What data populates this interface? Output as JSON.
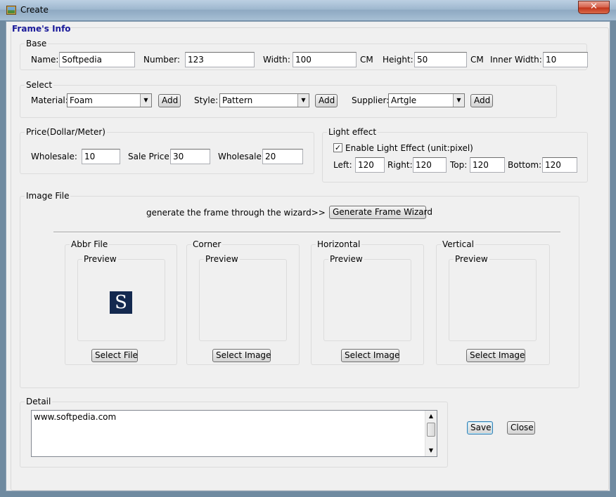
{
  "window": {
    "title": "Create",
    "close_glyph": "✕"
  },
  "frame_info": {
    "label": "Frame's Info"
  },
  "base": {
    "label": "Base",
    "name_label": "Name:",
    "name_value": "Softpedia",
    "number_label": "Number:",
    "number_value": "123",
    "width_label": "Width:",
    "width_value": "100",
    "width_unit": "CM",
    "height_label": "Height:",
    "height_value": "50",
    "height_unit": "CM",
    "inner_width_label": "Inner Width:",
    "inner_width_value": "10"
  },
  "select": {
    "label": "Select",
    "material_label": "Material:",
    "material_value": "Foam",
    "style_label": "Style:",
    "style_value": "Pattern",
    "supplier_label": "Supplier:",
    "supplier_value": "Artgle",
    "add_label": "Add"
  },
  "price": {
    "label": "Price(Dollar/Meter)",
    "wholesale_label": "Wholesale:",
    "wholesale_value": "10",
    "sale_price_label": "Sale Price:",
    "sale_price_value": "30",
    "wholesale2_label": "Wholesale:",
    "wholesale2_value": "20"
  },
  "light_effect": {
    "label": "Light effect",
    "enable_label": "Enable Light Effect  (unit:pixel)",
    "enable_checked": "✓",
    "left_label": "Left:",
    "left_value": "120",
    "right_label": "Right:",
    "right_value": "120",
    "top_label": "Top:",
    "top_value": "120",
    "bottom_label": "Bottom:",
    "bottom_value": "120"
  },
  "image_file": {
    "label": "Image File",
    "wizard_text": "generate the frame  through the wizard>>",
    "wizard_button": "Generate Frame Wizard",
    "panels": [
      {
        "title": "Abbr File",
        "preview": "Preview",
        "button": "Select File",
        "logo": "S"
      },
      {
        "title": "Corner",
        "preview": "Preview",
        "button": "Select Image"
      },
      {
        "title": "Horizontal",
        "preview": "Preview",
        "button": "Select Image"
      },
      {
        "title": "Vertical",
        "preview": "Preview",
        "button": "Select Image"
      }
    ]
  },
  "detail": {
    "label": "Detail",
    "value": "www.softpedia.com"
  },
  "actions": {
    "save": "Save",
    "close": "Close"
  },
  "colors": {
    "frame_info_label": "#1a1a9a",
    "logo_bg": "#14294f",
    "close_button": "#c2341a"
  }
}
